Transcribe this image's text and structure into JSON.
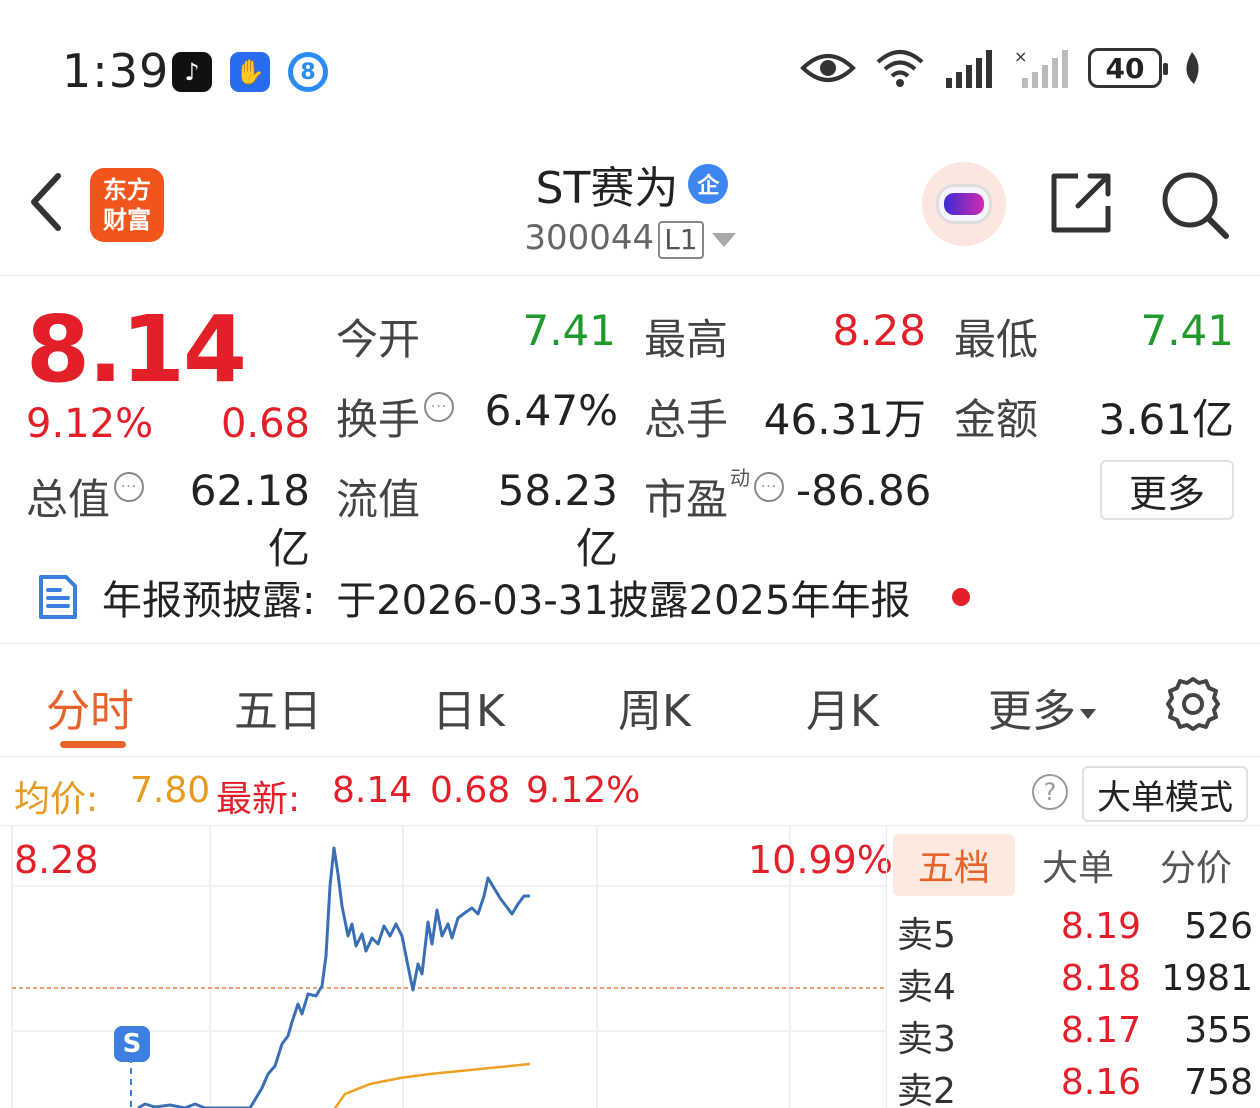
{
  "status_bar": {
    "time": "1:39",
    "battery": "40",
    "icons": [
      "tiktok-icon",
      "shield-app-icon",
      "eight-app-icon",
      "eye-icon",
      "wifi-icon",
      "signal-icon",
      "signal-x-icon",
      "battery-icon",
      "leaf-icon"
    ]
  },
  "header": {
    "logo_text": "东方财富",
    "title": "ST赛为",
    "qi_badge": "企",
    "code": "300044",
    "level": "L1"
  },
  "quote": {
    "price": "8.14",
    "change_pct": "9.12%",
    "change": "0.68",
    "stats": [
      {
        "label": "今开",
        "value": "7.41",
        "color": "green"
      },
      {
        "label": "最高",
        "value": "8.28",
        "color": "red"
      },
      {
        "label": "最低",
        "value": "7.41",
        "color": "green"
      },
      {
        "label": "换手",
        "value": "6.47%",
        "color": "default"
      },
      {
        "label": "总手",
        "value": "46.31万",
        "color": "default"
      },
      {
        "label": "金额",
        "value": "3.61亿",
        "color": "default"
      },
      {
        "label": "总值",
        "value": "62.18亿",
        "color": "default"
      },
      {
        "label": "流值",
        "value": "58.23亿",
        "color": "default"
      },
      {
        "label": "市盈",
        "value": "-86.86",
        "color": "default"
      }
    ],
    "pe_sup": "动",
    "more_label": "更多"
  },
  "notice": {
    "label": "年报预披露:",
    "text": "于2026-03-31披露2025年年报"
  },
  "tabs": {
    "items": [
      "分时",
      "五日",
      "日K",
      "周K",
      "月K",
      "更多"
    ],
    "active": "分时"
  },
  "summary": {
    "avg_label": "均价:",
    "avg_value": "7.80",
    "latest_label": "最新:",
    "latest_value": "8.14",
    "latest_change": "0.68",
    "latest_pct": "9.12%",
    "help": "?",
    "big_order_label": "大单模式"
  },
  "chart": {
    "high_price": "8.28",
    "high_pct": "10.99%",
    "marker": "S",
    "colors": {
      "price": "#3a6fb5",
      "avg": "#f0a020",
      "prev_close": "#e8a070"
    }
  },
  "order_book": {
    "tabs": [
      "五档",
      "大单",
      "分价"
    ],
    "active_tab": "五档",
    "rows": [
      {
        "label": "卖5",
        "price": "8.19",
        "volume": "526"
      },
      {
        "label": "卖4",
        "price": "8.18",
        "volume": "1981"
      },
      {
        "label": "卖3",
        "price": "8.17",
        "volume": "355"
      },
      {
        "label": "卖2",
        "price": "8.16",
        "volume": "758"
      }
    ]
  }
}
